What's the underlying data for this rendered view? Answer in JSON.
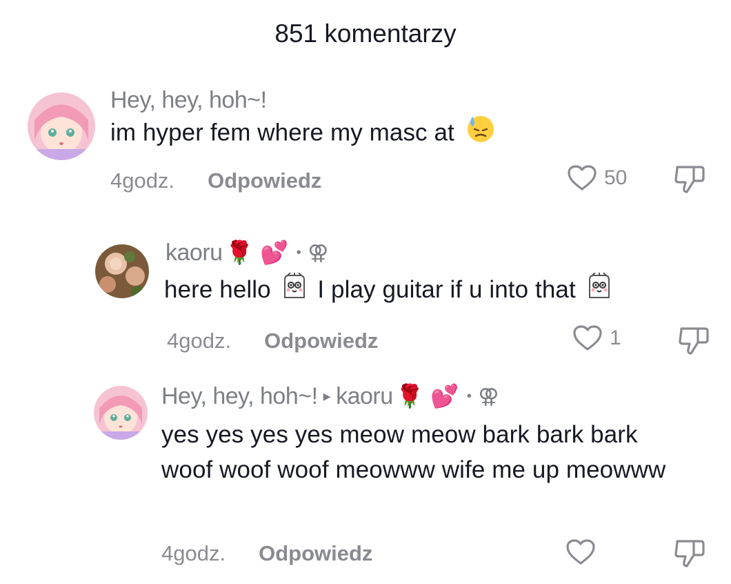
{
  "header": {
    "title": "851 komentarzy"
  },
  "comments": [
    {
      "username": "Hey, hey, hoh~!",
      "text": "im hyper fem where my masc at",
      "emoji": "😓",
      "time": "4godz.",
      "reply_label": "Odpowiedz",
      "likes": "50"
    },
    {
      "username": "kaoru",
      "name_emojis": "🌹 💕",
      "dot": "•",
      "name_symbol": "⚢",
      "text_part1": "here hello",
      "text_part2": "I play guitar if u into that",
      "time": "4godz.",
      "reply_label": "Odpowiedz",
      "likes": "1"
    },
    {
      "username": "Hey, hey, hoh~!",
      "arrow": "▸",
      "reply_to": "kaoru",
      "name_emojis": "🌹 💕",
      "dot": "•",
      "name_symbol": "⚢",
      "text": "yes yes yes yes meow meow bark bark bark woof woof woof meowww wife me up meowww",
      "time": "4godz.",
      "reply_label": "Odpowiedz",
      "likes": ""
    }
  ],
  "colors": {
    "text": "#161823",
    "muted": "#7d7f86",
    "avatar_pink": "#f3b6c9"
  },
  "icons": [
    "heart-outline-icon",
    "thumbs-down-icon",
    "sweat-emoji-icon",
    "ghost-emoji-icon"
  ]
}
